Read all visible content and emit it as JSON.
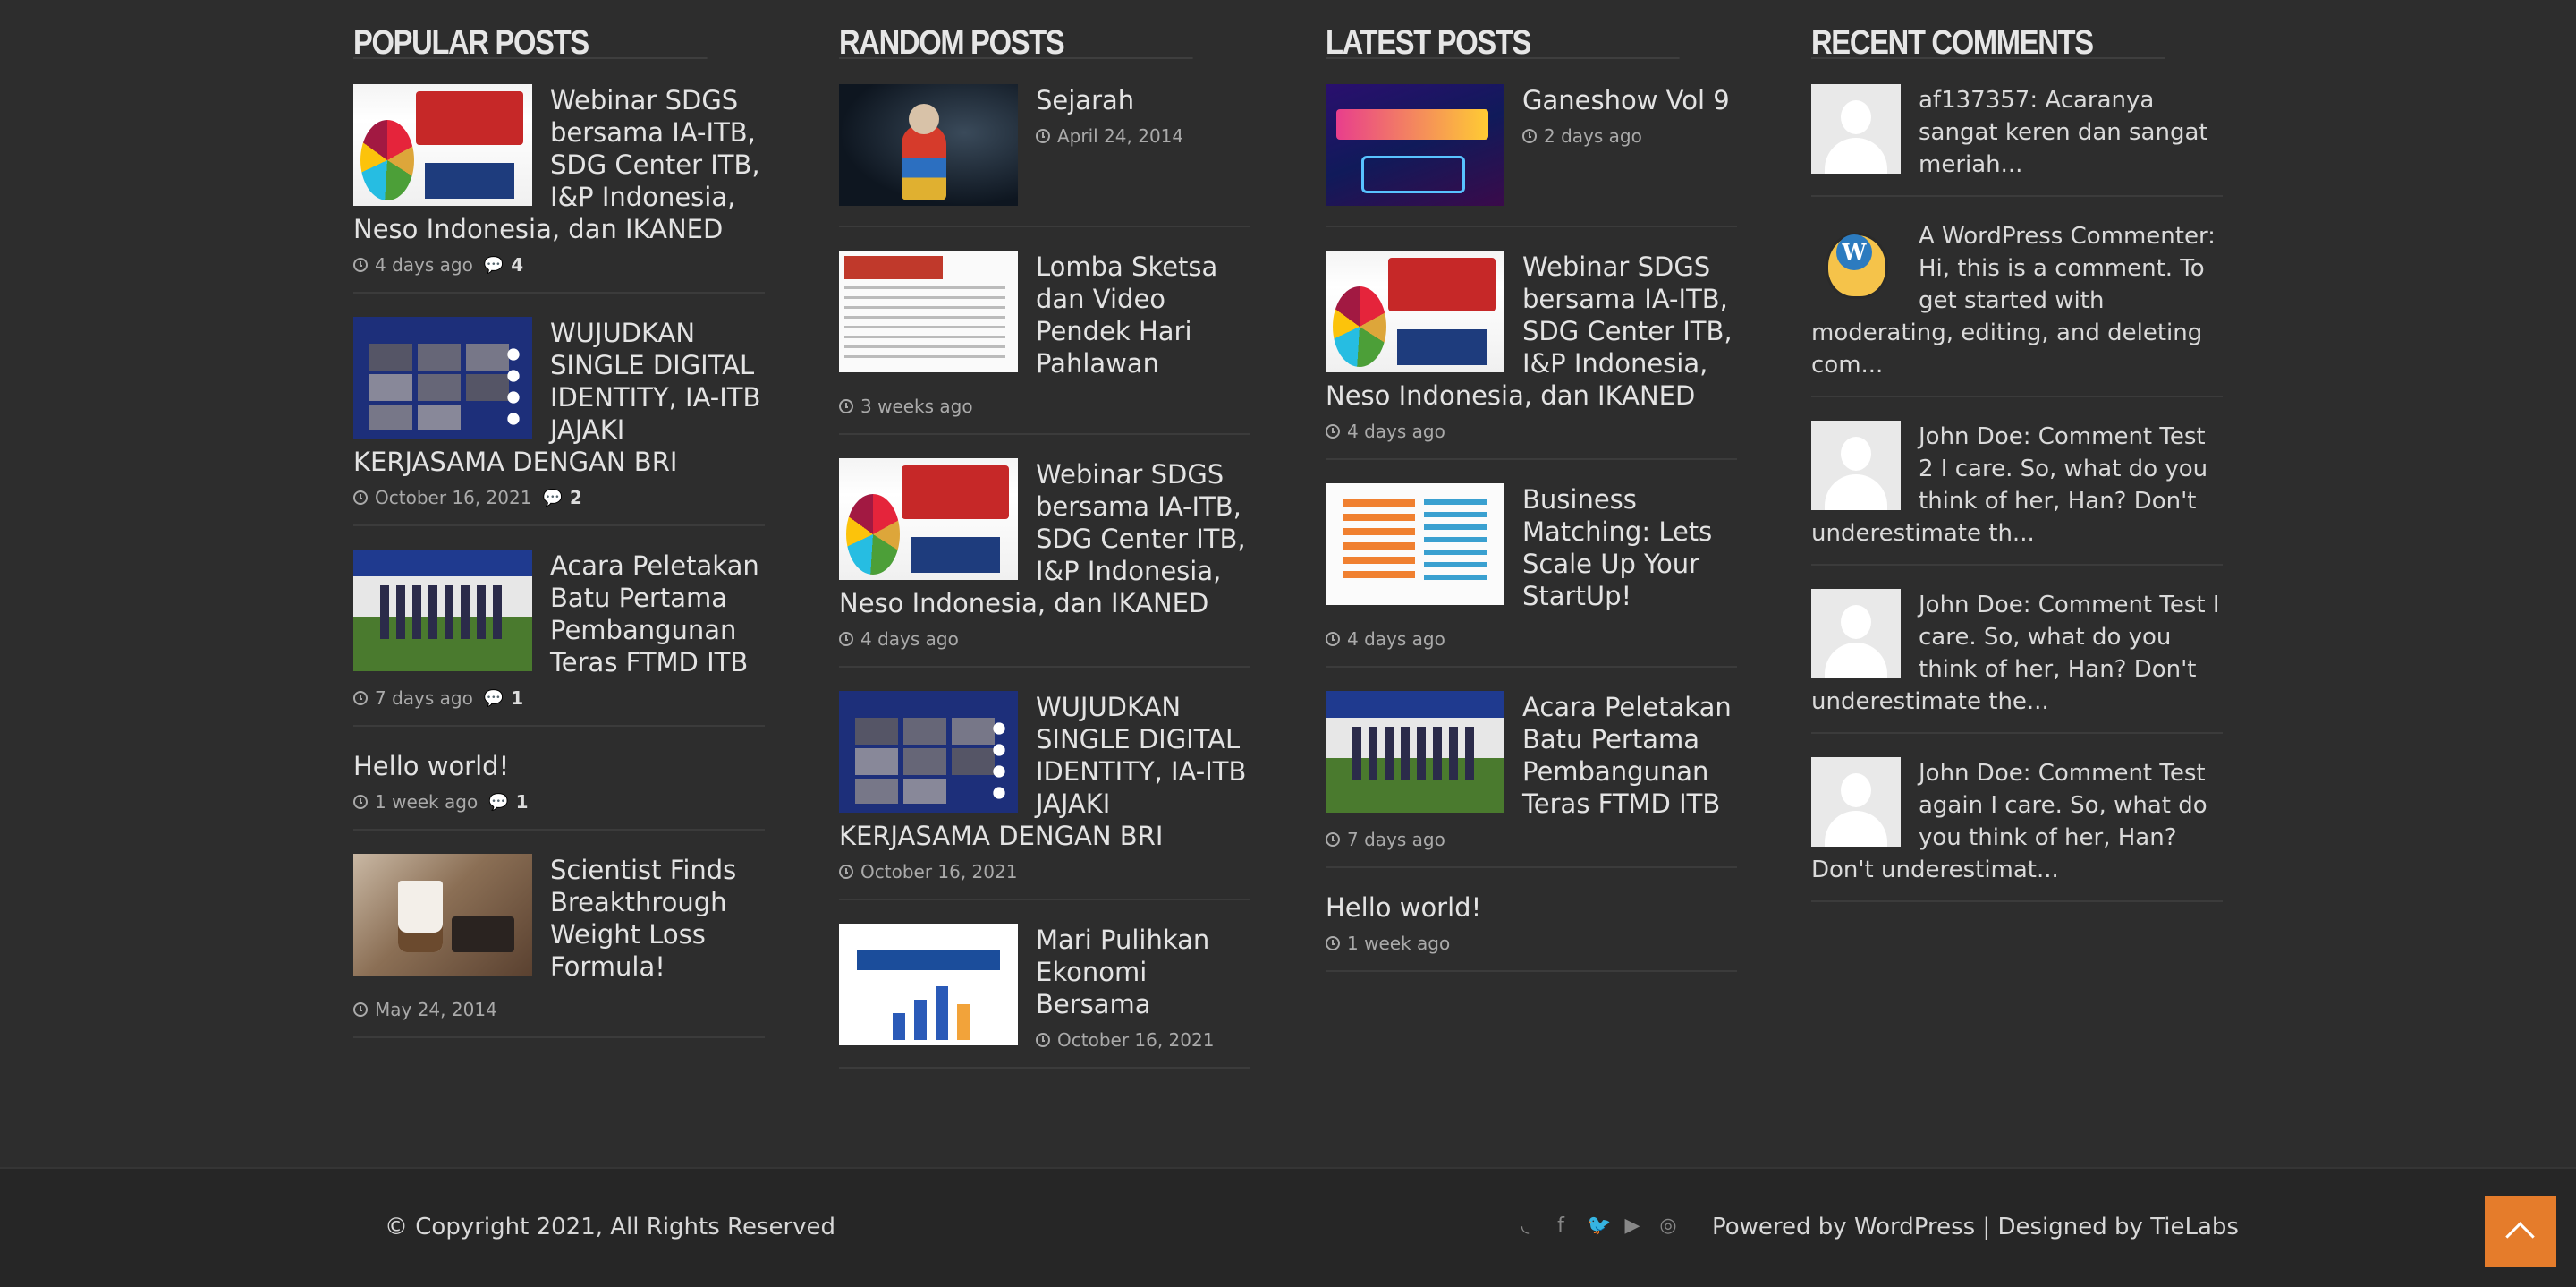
{
  "popular": {
    "title": "POPULAR POSTS",
    "items": [
      {
        "title": "Webinar SDGS bersama IA-ITB, SDG Center ITB, I&P Indonesia, Neso Indonesia, dan IKANED",
        "date": "4 days ago",
        "comments": "4",
        "thumb": "sdgs-webinar-image"
      },
      {
        "title": "WUJUDKAN SINGLE DIGITAL IDENTITY, IA-ITB JAJAKI KERJASAMA DENGAN BRI",
        "date": "October 16, 2021",
        "comments": "2",
        "thumb": "zoom-meeting-image"
      },
      {
        "title": "Acara Peletakan Batu Pertama Pembangunan Teras FTMD ITB",
        "date": "7 days ago",
        "comments": "1",
        "thumb": "teras-ftmd-image"
      },
      {
        "title": "Hello world!",
        "date": "1 week ago",
        "comments": "1"
      },
      {
        "title": "Scientist Finds Breakthrough Weight Loss Formula!",
        "date": "May 24, 2014",
        "thumb": "coffee-image"
      }
    ]
  },
  "random": {
    "title": "RANDOM POSTS",
    "items": [
      {
        "title": "Sejarah",
        "date": "April 24, 2014",
        "thumb": "child-image"
      },
      {
        "title": "Lomba Sketsa dan Video Pendek Hari Pahlawan",
        "date": "3 weeks ago",
        "thumb": "sketsa-image"
      },
      {
        "title": "Webinar SDGS bersama IA-ITB, SDG Center ITB, I&P Indonesia, Neso Indonesia, dan IKANED",
        "date": "4 days ago",
        "thumb": "sdgs-webinar-image"
      },
      {
        "title": "WUJUDKAN SINGLE DIGITAL IDENTITY, IA-ITB JAJAKI KERJASAMA DENGAN BRI",
        "date": "October 16, 2021",
        "thumb": "zoom-meeting-image"
      },
      {
        "title": "Mari Pulihkan Ekonomi Bersama",
        "date": "October 16, 2021",
        "thumb": "pulihkan-ekonomi-image"
      }
    ]
  },
  "latest": {
    "title": "LATEST POSTS",
    "items": [
      {
        "title": "Ganeshow Vol 9",
        "date": "2 days ago",
        "thumb": "ganeshow-image"
      },
      {
        "title": "Webinar SDGS bersama IA-ITB, SDG Center ITB, I&P Indonesia, Neso Indonesia, dan IKANED",
        "date": "4 days ago",
        "thumb": "sdgs-webinar-image"
      },
      {
        "title": "Business Matching: Lets Scale Up Your StartUp!",
        "date": "4 days ago",
        "thumb": "business-matching-image"
      },
      {
        "title": "Acara Peletakan Batu Pertama Pembangunan Teras FTMD ITB",
        "date": "7 days ago",
        "thumb": "teras-ftmd-image"
      },
      {
        "title": "Hello world!",
        "date": "1 week ago"
      }
    ]
  },
  "comments": {
    "title": "RECENT COMMENTS",
    "items": [
      {
        "text": "af137357: Acaranya sangat keren dan sangat meriah...",
        "avatar": "default-avatar"
      },
      {
        "text": "A WordPress Commenter: Hi, this is a comment. To get started with moderating, editing, and deleting com...",
        "avatar": "wapuu-avatar"
      },
      {
        "text": "John Doe: Comment Test 2 I care. So, what do you think of her, Han? Don't underestimate th...",
        "avatar": "default-avatar"
      },
      {
        "text": "John Doe: Comment Test I care. So, what do you think of her, Han? Don't underestimate the...",
        "avatar": "default-avatar"
      },
      {
        "text": "John Doe: Comment Test again I care. So, what do you think of her, Han? Don't underestimat...",
        "avatar": "default-avatar"
      }
    ]
  },
  "footer": {
    "copyright": "© Copyright 2021, All Rights Reserved",
    "social_icons": [
      "rss-icon",
      "facebook-icon",
      "twitter-icon",
      "youtube-icon",
      "instagram-icon"
    ],
    "powered": "Powered by WordPress | Designed by TieLabs"
  },
  "colors": {
    "background": "#2d2d2d",
    "footer": "#262626",
    "accent": "#e57c2b"
  }
}
